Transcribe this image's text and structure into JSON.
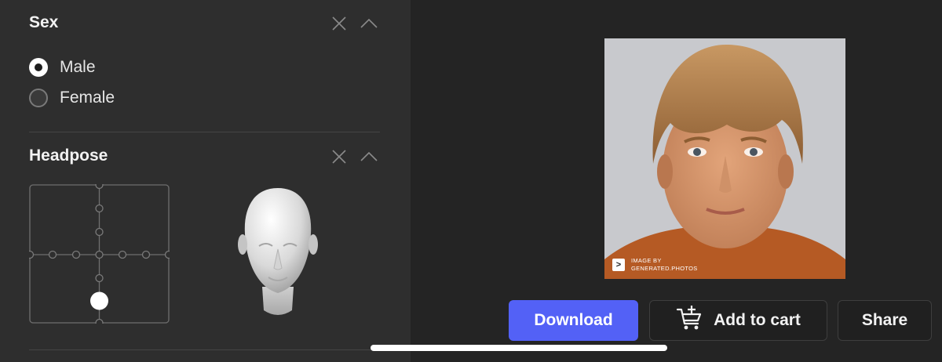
{
  "sidebar": {
    "sex": {
      "title": "Sex",
      "options": [
        {
          "label": "Male",
          "selected": true
        },
        {
          "label": "Female",
          "selected": false
        }
      ]
    },
    "headpose": {
      "title": "Headpose",
      "selected_pitch_step": -2,
      "selected_yaw_step": 0
    }
  },
  "preview": {
    "watermark_line1": "IMAGE BY",
    "watermark_line2": "GENERATED.PHOTOS",
    "watermark_logo": ">"
  },
  "actions": {
    "download_label": "Download",
    "add_to_cart_label": "Add to cart",
    "share_label": "Share"
  },
  "colors": {
    "accent": "#5361f6",
    "panel_bg": "#2e2e2e",
    "page_bg": "#242424"
  }
}
